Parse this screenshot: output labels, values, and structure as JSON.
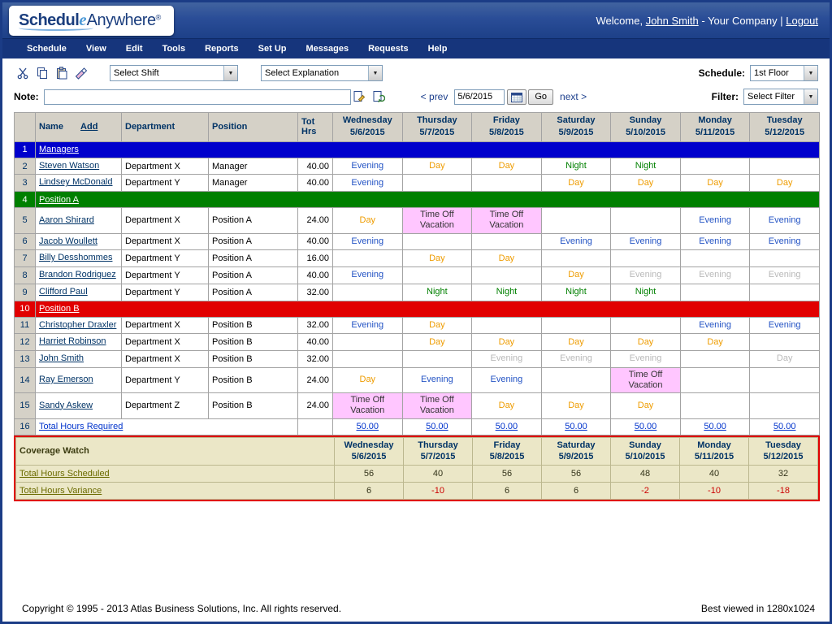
{
  "colors": {
    "day": "#ee9c00",
    "evening": "#2353c4",
    "night": "#008000",
    "ghost": "#b9b9b9",
    "vacation-bg": "#ffc6ff",
    "band-managers": "#0000cc",
    "band-position-a": "#008000",
    "band-position-b": "#e10000",
    "total-link": "#0033cc",
    "coverage-link": "#6b6b00",
    "negative": "#cc0000"
  },
  "icons": {
    "toolbar": [
      "cut-icon",
      "copy-icon",
      "paste-icon",
      "eraser-icon"
    ],
    "note": [
      "edit-note-icon",
      "refresh-note-icon"
    ],
    "date": "calendar-icon"
  },
  "header": {
    "logo_schedul": "Schedul",
    "logo_e": "e",
    "logo_anywhere": "Anywhere",
    "logo_reg": "®",
    "welcome_prefix": "Welcome,",
    "user_link": "John Smith",
    "company_suffix": "- Your Company",
    "divider": "|",
    "logout": "Logout"
  },
  "menu": {
    "items": [
      "Schedule",
      "View",
      "Edit",
      "Tools",
      "Reports",
      "Set Up",
      "Messages",
      "Requests",
      "Help"
    ]
  },
  "toolbar": {
    "shift_select": "Select Shift",
    "explanation_select": "Select Explanation",
    "schedule_label": "Schedule:",
    "schedule_select": "1st Floor",
    "note_label": "Note:",
    "note_value": "",
    "prev_link": "< prev",
    "date_value": "5/6/2015",
    "go_button": "Go",
    "next_link": "next >",
    "filter_label": "Filter:",
    "filter_select": "Select Filter"
  },
  "table": {
    "name_header": "Name",
    "add_link": "Add",
    "department_header": "Department",
    "position_header": "Position",
    "tot_hrs_header": "Tot Hrs",
    "days": [
      {
        "name": "Wednesday",
        "date": "5/6/2015"
      },
      {
        "name": "Thursday",
        "date": "5/7/2015"
      },
      {
        "name": "Friday",
        "date": "5/8/2015"
      },
      {
        "name": "Saturday",
        "date": "5/9/2015"
      },
      {
        "name": "Sunday",
        "date": "5/10/2015"
      },
      {
        "name": "Monday",
        "date": "5/11/2015"
      },
      {
        "name": "Tuesday",
        "date": "5/12/2015"
      }
    ],
    "rows": [
      {
        "type": "band",
        "num": "1",
        "label": "Managers",
        "band": "band-managers"
      },
      {
        "type": "person",
        "num": "2",
        "name": "Steven Watson",
        "dept": "Department X",
        "pos": "Manager",
        "hrs": "40.00",
        "cells": [
          [
            "Evening",
            "evening"
          ],
          [
            "Day",
            "day"
          ],
          [
            "Day",
            "day"
          ],
          [
            "Night",
            "night"
          ],
          [
            "Night",
            "night"
          ],
          [
            "",
            ""
          ],
          [
            "",
            ""
          ]
        ]
      },
      {
        "type": "person",
        "num": "3",
        "name": "Lindsey McDonald",
        "dept": "Department Y",
        "pos": "Manager",
        "hrs": "40.00",
        "cells": [
          [
            "Evening",
            "evening"
          ],
          [
            "",
            ""
          ],
          [
            "",
            ""
          ],
          [
            "Day",
            "day"
          ],
          [
            "Day",
            "day"
          ],
          [
            "Day",
            "day"
          ],
          [
            "Day",
            "day"
          ]
        ]
      },
      {
        "type": "band",
        "num": "4",
        "label": "Position A",
        "band": "band-position-a"
      },
      {
        "type": "person",
        "num": "5",
        "name": "Aaron Shirard",
        "dept": "Department X",
        "pos": "Position A",
        "hrs": "24.00",
        "cells": [
          [
            "Day",
            "day"
          ],
          [
            "Time Off Vacation",
            "vacation"
          ],
          [
            "Time Off Vacation",
            "vacation"
          ],
          [
            "",
            ""
          ],
          [
            "",
            ""
          ],
          [
            "Evening",
            "evening"
          ],
          [
            "Evening",
            "evening"
          ]
        ]
      },
      {
        "type": "person",
        "num": "6",
        "name": "Jacob Woullett",
        "dept": "Department X",
        "pos": "Position A",
        "hrs": "40.00",
        "cells": [
          [
            "Evening",
            "evening"
          ],
          [
            "",
            ""
          ],
          [
            "",
            ""
          ],
          [
            "Evening",
            "evening"
          ],
          [
            "Evening",
            "evening"
          ],
          [
            "Evening",
            "evening"
          ],
          [
            "Evening",
            "evening"
          ]
        ]
      },
      {
        "type": "person",
        "num": "7",
        "name": "Billy Desshommes",
        "dept": "Department Y",
        "pos": "Position A",
        "hrs": "16.00",
        "cells": [
          [
            "",
            ""
          ],
          [
            "Day",
            "day"
          ],
          [
            "Day",
            "day"
          ],
          [
            "",
            ""
          ],
          [
            "",
            ""
          ],
          [
            "",
            ""
          ],
          [
            "",
            ""
          ]
        ]
      },
      {
        "type": "person",
        "num": "8",
        "name": "Brandon Rodriguez",
        "dept": "Department Y",
        "pos": "Position A",
        "hrs": "40.00",
        "cells": [
          [
            "Evening",
            "evening"
          ],
          [
            "",
            ""
          ],
          [
            "",
            ""
          ],
          [
            "Day",
            "day"
          ],
          [
            "Evening",
            "ghost"
          ],
          [
            "Evening",
            "ghost"
          ],
          [
            "Evening",
            "ghost"
          ]
        ]
      },
      {
        "type": "person",
        "num": "9",
        "name": "Clifford Paul",
        "dept": "Department Y",
        "pos": "Position A",
        "hrs": "32.00",
        "cells": [
          [
            "",
            ""
          ],
          [
            "Night",
            "night"
          ],
          [
            "Night",
            "night"
          ],
          [
            "Night",
            "night"
          ],
          [
            "Night",
            "night"
          ],
          [
            "",
            ""
          ],
          [
            "",
            ""
          ]
        ]
      },
      {
        "type": "band",
        "num": "10",
        "label": "Position B",
        "band": "band-position-b"
      },
      {
        "type": "person",
        "num": "11",
        "name": "Christopher Draxler",
        "dept": "Department X",
        "pos": "Position B",
        "hrs": "32.00",
        "cells": [
          [
            "Evening",
            "evening"
          ],
          [
            "Day",
            "day"
          ],
          [
            "",
            ""
          ],
          [
            "",
            ""
          ],
          [
            "",
            ""
          ],
          [
            "Evening",
            "evening"
          ],
          [
            "Evening",
            "evening"
          ]
        ]
      },
      {
        "type": "person",
        "num": "12",
        "name": "Harriet Robinson",
        "dept": "Department X",
        "pos": "Position B",
        "hrs": "40.00",
        "cells": [
          [
            "",
            ""
          ],
          [
            "Day",
            "day"
          ],
          [
            "Day",
            "day"
          ],
          [
            "Day",
            "day"
          ],
          [
            "Day",
            "day"
          ],
          [
            "Day",
            "day"
          ],
          [
            "",
            ""
          ]
        ]
      },
      {
        "type": "person",
        "num": "13",
        "name": "John Smith",
        "dept": "Department X",
        "pos": "Position B",
        "hrs": "32.00",
        "cells": [
          [
            "",
            ""
          ],
          [
            "",
            ""
          ],
          [
            "Evening",
            "ghost"
          ],
          [
            "Evening",
            "ghost"
          ],
          [
            "Evening",
            "ghost"
          ],
          [
            "",
            ""
          ],
          [
            "Day",
            "ghost"
          ]
        ]
      },
      {
        "type": "person",
        "num": "14",
        "name": "Ray Emerson",
        "dept": "Department Y",
        "pos": "Position B",
        "hrs": "24.00",
        "cells": [
          [
            "Day",
            "day"
          ],
          [
            "Evening",
            "evening"
          ],
          [
            "Evening",
            "evening"
          ],
          [
            "",
            ""
          ],
          [
            "Time Off Vacation",
            "vacation"
          ],
          [
            "",
            ""
          ],
          [
            "",
            ""
          ]
        ]
      },
      {
        "type": "person",
        "num": "15",
        "name": "Sandy Askew",
        "dept": "Department Z",
        "pos": "Position B",
        "hrs": "24.00",
        "cells": [
          [
            "Time Off Vacation",
            "vacation"
          ],
          [
            "Time Off Vacation",
            "vacation"
          ],
          [
            "Day",
            "day"
          ],
          [
            "Day",
            "day"
          ],
          [
            "Day",
            "day"
          ],
          [
            "",
            ""
          ],
          [
            "",
            ""
          ]
        ]
      },
      {
        "type": "total",
        "num": "16",
        "label": "Total Hours Required",
        "values": [
          "50.00",
          "50.00",
          "50.00",
          "50.00",
          "50.00",
          "50.00",
          "50.00"
        ]
      }
    ]
  },
  "coverage": {
    "title": "Coverage Watch",
    "rows": [
      {
        "label": "Total Hours Scheduled",
        "values": [
          "56",
          "40",
          "56",
          "56",
          "48",
          "40",
          "32"
        ]
      },
      {
        "label": "Total Hours Variance",
        "values": [
          "6",
          "-10",
          "6",
          "6",
          "-2",
          "-10",
          "-18"
        ]
      }
    ]
  },
  "footer": {
    "copyright": "Copyright © 1995 - 2013 Atlas Business Solutions, Inc. All rights reserved.",
    "best_viewed": "Best viewed in 1280x1024"
  }
}
